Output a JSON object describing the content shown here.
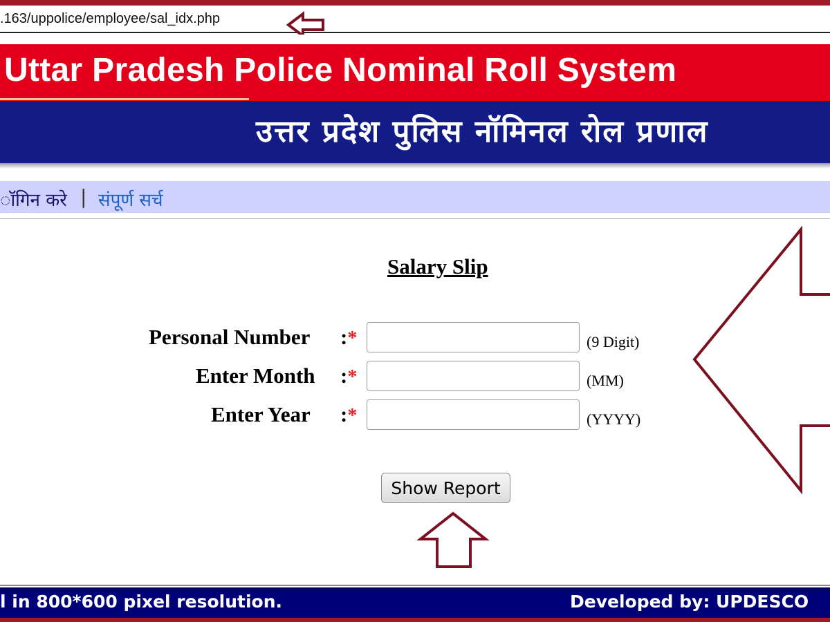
{
  "browser": {
    "url": ".163/uppolice/employee/sal_idx.php"
  },
  "banner": {
    "title_en": "Uttar Pradesh Police Nominal Roll System",
    "title_hi": "उत्तर प्रदेश पुलिस नॉमिनल रोल प्रणाल"
  },
  "menu": {
    "login": "ॉगिन करे",
    "separator": "|",
    "search": "संपूर्ण सर्च"
  },
  "form": {
    "title": "Salary Slip",
    "fields": [
      {
        "label": "Personal Number",
        "colon": ":",
        "required_mark": "*",
        "value": "",
        "hint": "(9 Digit)"
      },
      {
        "label": "Enter Month",
        "colon": ":",
        "required_mark": "*",
        "value": "",
        "hint": "(MM)"
      },
      {
        "label": "Enter Year",
        "colon": ":",
        "required_mark": "*",
        "value": "",
        "hint": "(YYYY)"
      }
    ],
    "submit_label": "Show Report"
  },
  "footer": {
    "left_text": "l in 800*600 pixel resolution.",
    "right_text": "Developed by: UPDESCO"
  },
  "colors": {
    "banner_red": "#e2001a",
    "banner_blue": "#131b86",
    "menu_bg": "#cfd1ff",
    "footer_bg": "#010277",
    "annotation_arrow": "#7a1020",
    "required_star": "#e8232b"
  },
  "icons": {
    "url_pointer": "arrow-left-outline-icon",
    "form_pointer": "arrow-left-large-outline-icon",
    "button_pointer": "arrow-up-outline-icon"
  }
}
